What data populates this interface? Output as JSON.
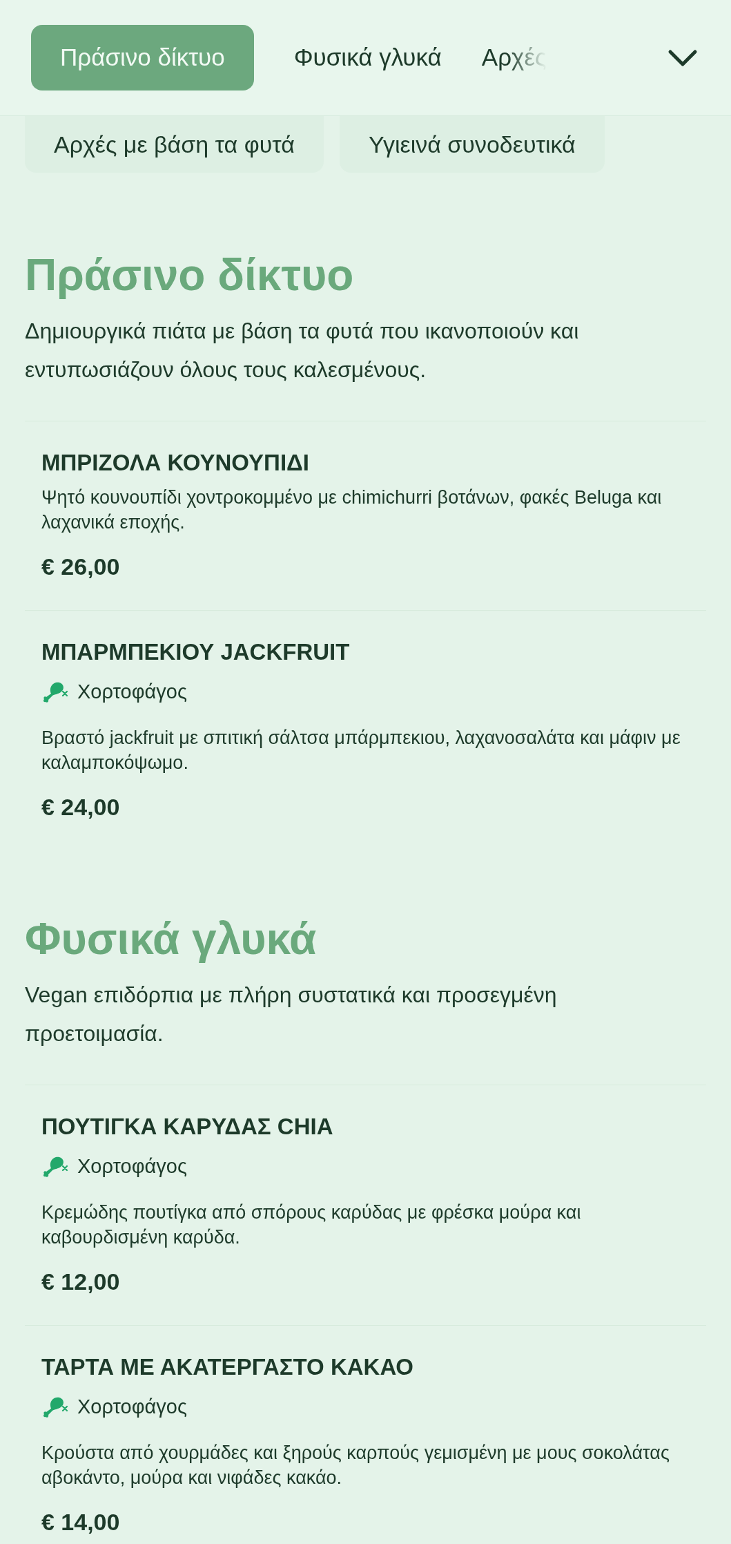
{
  "nav": {
    "tabs": [
      {
        "label": "Πράσινο δίκτυο",
        "selected": true
      },
      {
        "label": "Φυσικά γλυκά",
        "selected": false
      },
      {
        "label": "Αρχές",
        "selected": false
      }
    ]
  },
  "chips": [
    {
      "label": "Αρχές με βάση τα φυτά"
    },
    {
      "label": "Υγιεινά συνοδευτικά"
    }
  ],
  "sections": [
    {
      "title": "Πράσινο δίκτυο",
      "description": "Δημιουργικά πιάτα με βάση τα φυτά που ικανοποιούν και εντυπωσιάζουν όλους τους καλεσμένους.",
      "items": [
        {
          "name": "ΜΠΡΙΖΟΛΑ ΚΟΥΝΟΥΠΙΔΙ",
          "description": "Ψητό κουνουπίδι χοντροκομμένο με chimichurri βοτάνων, φακές Beluga και λαχανικά εποχής.",
          "price": "€ 26,00"
        },
        {
          "name": "ΜΠΑΡΜΠΕΚΙΟΥ JACKFRUIT",
          "tags": [
            {
              "label": "Χορτοφάγος"
            }
          ],
          "description": "Βραστό jackfruit με σπιτική σάλτσα μπάρμπεκιου, λαχανοσαλάτα και μάφιν με καλαμποκόψωμο.",
          "price": "€ 24,00"
        }
      ]
    },
    {
      "title": "Φυσικά γλυκά",
      "description": "Vegan επιδόρπια με πλήρη συστατικά και προσεγμένη προετοιμασία.",
      "items": [
        {
          "name": "ΠΟΥΤΙΓΚΑ ΚΑΡΥΔΑΣ CHIA",
          "tags": [
            {
              "label": "Χορτοφάγος"
            }
          ],
          "description": "Κρεμώδης πουτίγκα από σπόρους καρύδας με φρέσκα μούρα και καβουρδισμένη καρύδα.",
          "price": "€ 12,00"
        },
        {
          "name": "ΤΑΡΤΑ ΜΕ ΑΚΑΤΕΡΓΑΣΤΟ ΚΑΚΑΟ",
          "tags": [
            {
              "label": "Χορτοφάγος"
            }
          ],
          "description": "Κρούστα από χουρμάδες και ξηρούς καρπούς γεμισμένη με μους σοκολάτας αβοκάντο, μούρα και νιφάδες κακάο.",
          "price": "€ 14,00"
        }
      ]
    }
  ]
}
